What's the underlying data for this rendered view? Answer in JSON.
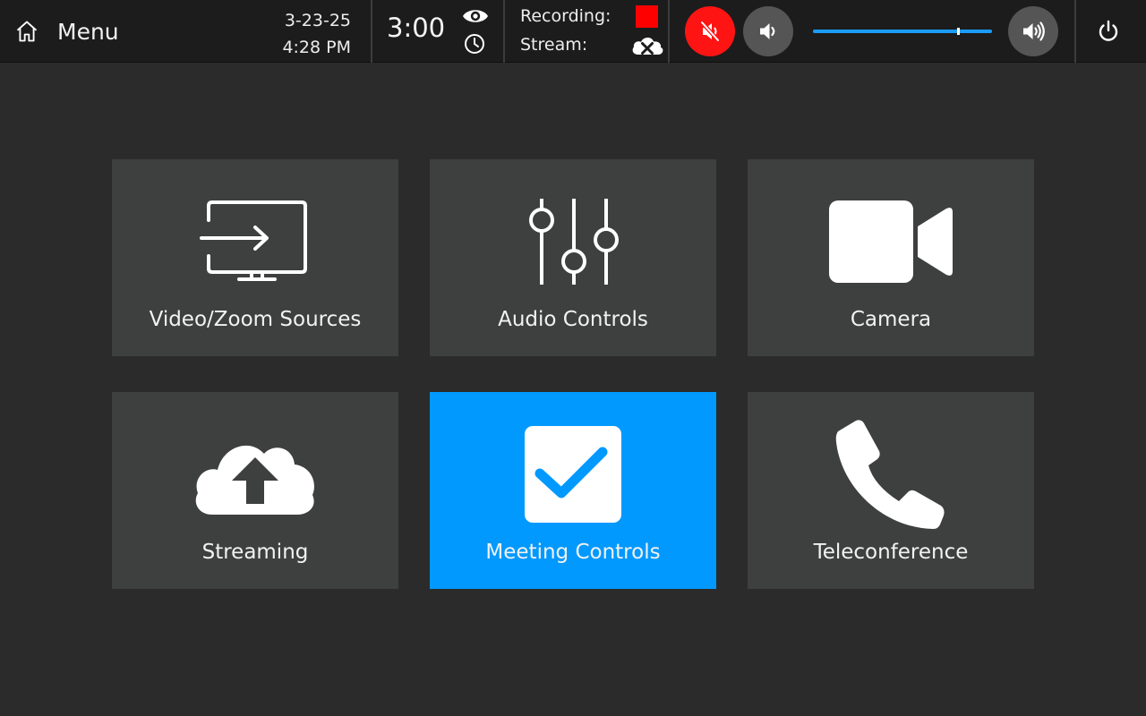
{
  "header": {
    "menu_label": "Menu",
    "date": "3-23-25",
    "time": "4:28 PM",
    "timer": "3:00",
    "recording_label": "Recording:",
    "stream_label": "Stream:",
    "recording_color": "#ff0000",
    "volume_level_percent": 81
  },
  "icons": {
    "home": "home-icon",
    "eye": "eye-icon",
    "clock": "clock-icon",
    "stream_status": "cloud-disconnected-icon",
    "mute": "speaker-muted-icon",
    "volume_down": "speaker-low-icon",
    "volume_up": "speaker-high-icon",
    "power": "power-icon"
  },
  "tiles": [
    {
      "label": "Video/Zoom Sources",
      "icon": "monitor-input-icon",
      "active": false
    },
    {
      "label": "Audio Controls",
      "icon": "sliders-icon",
      "active": false
    },
    {
      "label": "Camera",
      "icon": "video-camera-icon",
      "active": false
    },
    {
      "label": "Streaming",
      "icon": "cloud-upload-icon",
      "active": false
    },
    {
      "label": "Meeting Controls",
      "icon": "checkbox-icon",
      "active": true
    },
    {
      "label": "Teleconference",
      "icon": "phone-icon",
      "active": false
    }
  ],
  "colors": {
    "accent": "#0299ff",
    "mute_red": "#ff1414",
    "tile_bg": "#3e3f3f",
    "bar_bg": "#1c1c1c"
  }
}
